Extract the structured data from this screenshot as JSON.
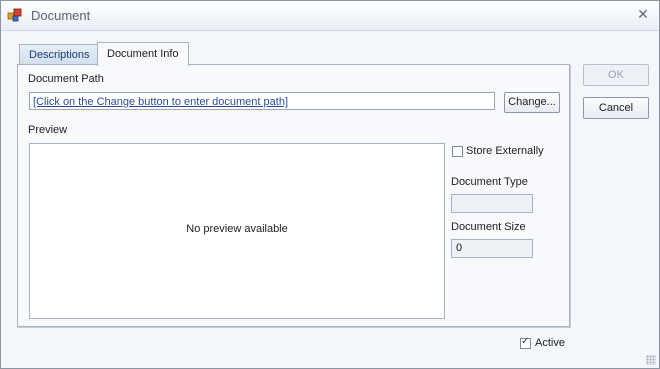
{
  "window": {
    "title": "Document"
  },
  "tabs": [
    {
      "label": "Descriptions"
    },
    {
      "label": "Document Info",
      "active": true
    }
  ],
  "document_info": {
    "path_label": "Document Path",
    "path_value": "[Click on the Change button to enter document path]",
    "change_button": "Change...",
    "preview_label": "Preview",
    "preview_text": "No preview available",
    "store_externally_label": "Store Externally",
    "store_externally_checked": false,
    "document_type_label": "Document Type",
    "document_type_value": "",
    "document_size_label": "Document Size",
    "document_size_value": "0"
  },
  "buttons": {
    "ok": "OK",
    "cancel": "Cancel"
  },
  "footer": {
    "active_label": "Active",
    "active_checked": true
  }
}
